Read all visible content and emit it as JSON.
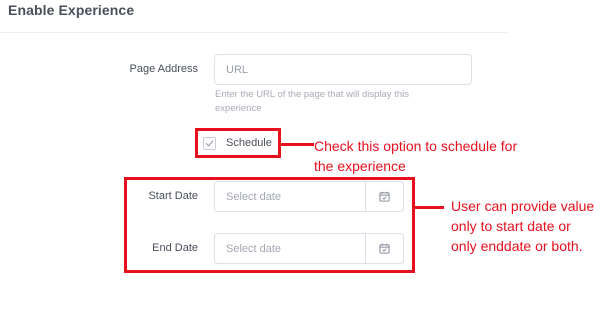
{
  "page_title": "Enable Experience",
  "form": {
    "page_address_label": "Page Address",
    "page_address_placeholder": "URL",
    "page_address_help_line1": "Enter the URL of the page that will display this",
    "page_address_help_line2": "experience",
    "schedule_label": "Schedule",
    "start_date_label": "Start Date",
    "start_date_placeholder": "Select date",
    "end_date_label": "End Date",
    "end_date_placeholder": "Select date"
  },
  "annotations": {
    "schedule_note_line1": "Check this option to schedule for",
    "schedule_note_line2": "the experience",
    "dates_note_line1": "User can provide value",
    "dates_note_line2": "only to start date or",
    "dates_note_line3": "only enddate or both."
  },
  "colors": {
    "annotation": "#e8101e",
    "label": "#4a4f5a",
    "border": "#dcdfe6"
  },
  "icons": {
    "checkbox": "checkmark-icon",
    "date_picker": "calendar-icon"
  }
}
